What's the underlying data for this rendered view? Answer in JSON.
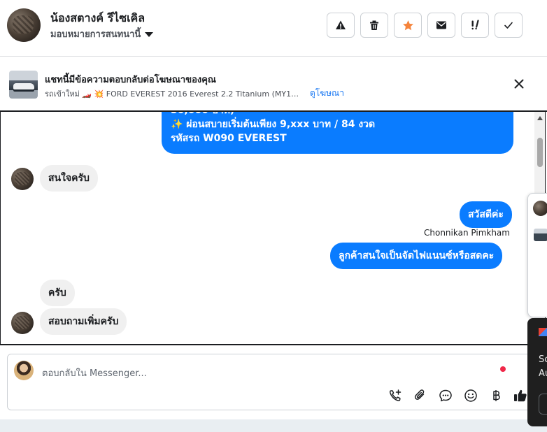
{
  "header": {
    "contact_name": "น้องสตางค์ รีไซเคิล",
    "assign_label": "มอบหมายการสนทนานี้",
    "actions": [
      {
        "name": "spam-button",
        "icon": "warning-icon"
      },
      {
        "name": "delete-button",
        "icon": "trash-icon"
      },
      {
        "name": "star-button",
        "icon": "star-icon"
      },
      {
        "name": "mark-unread-button",
        "icon": "envelope-icon"
      },
      {
        "name": "follow-up-button",
        "icon": "exclamation-icon"
      },
      {
        "name": "mark-done-button",
        "icon": "check-icon"
      }
    ],
    "star_color": "#f5833b"
  },
  "ad_banner": {
    "title": "แชทนี้มีข้อความตอบกลับต่อโฆษณาของคุณ",
    "subtitle": "รถเข้าใหม่ 🏎️ 💥 FORD EVEREST 2016 Everest 2.2 Titanium (MY1…",
    "link": "ดูโฆษณา"
  },
  "messages": {
    "partial_top": "50,000 บาท)",
    "out_promo_line1": "✨ ผ่อนสบายเริ่มต้นเพียง 9,xxx บาท / 84 งวด",
    "out_promo_line2": "รหัสรถ W090 EVEREST",
    "in_1": "สนใจครับ",
    "out_hello": "สวัสดีค่ะ",
    "sender_name": "Chonnikan Pimkham",
    "out_question": "ลูกค้าสนใจเป็นจัดไฟแนนซ์หรือสดคะ",
    "in_2": "ครับ",
    "in_3": "สอบถามเพิ่มครับ"
  },
  "composer": {
    "placeholder": "ตอบกลับใน Messenger...",
    "tools": [
      "call-add-icon",
      "paperclip-icon",
      "chat-bubble-icon",
      "emoji-icon",
      "baht-icon",
      "thumbs-up-icon"
    ]
  },
  "side_toast": {
    "line1": "Sc",
    "line2": "Au"
  },
  "colors": {
    "accent": "#0a7cff",
    "link": "#1877f2",
    "notification_dot": "#f02849"
  }
}
